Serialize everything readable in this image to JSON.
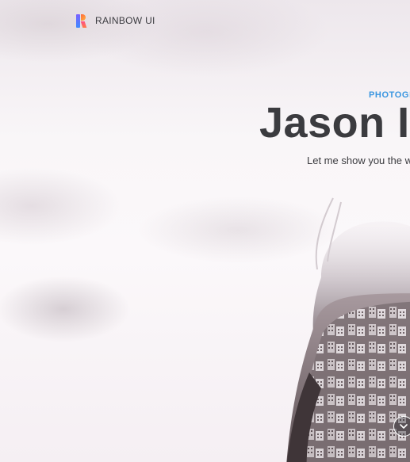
{
  "brand": {
    "name": "RAINBOW UI",
    "logo_icon": "rainbow-logo-icon"
  },
  "hero": {
    "eyebrow": "PHOTOGR",
    "title": "Jason I",
    "subtitle": "Let me show you the wo"
  },
  "scroll_button": {
    "icon": "chevron-down-icon"
  },
  "colors": {
    "accent": "#3a96e0",
    "title": "#3b3b3f",
    "background": "#f9f6f8"
  }
}
